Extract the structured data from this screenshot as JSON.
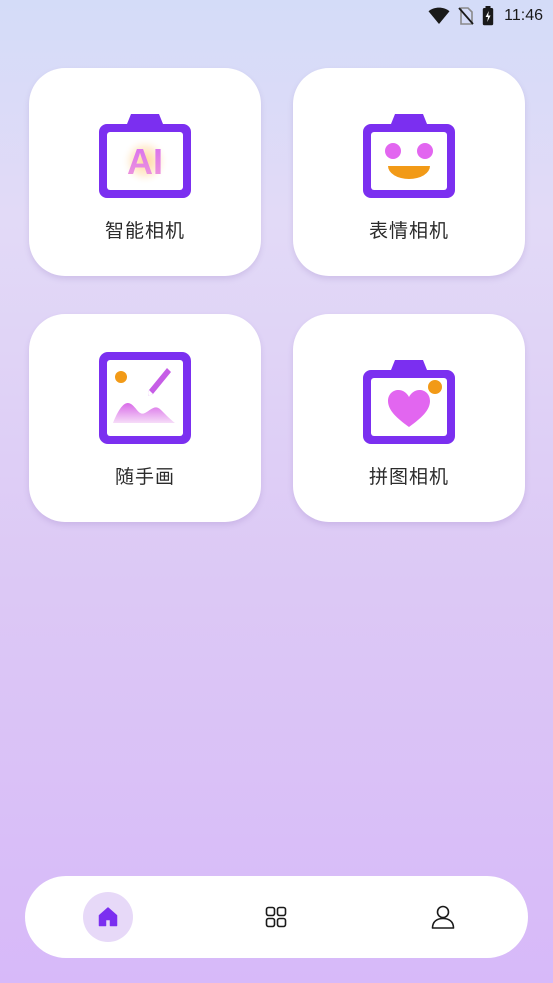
{
  "status_bar": {
    "time": "11:46",
    "icons": [
      "wifi-icon",
      "no-sim-icon",
      "battery-charging-icon"
    ]
  },
  "features": [
    {
      "label": "智能相机",
      "icon": "ai-camera-icon",
      "icon_text": "AI"
    },
    {
      "label": "表情相机",
      "icon": "emoji-camera-icon"
    },
    {
      "label": "随手画",
      "icon": "doodle-icon"
    },
    {
      "label": "拼图相机",
      "icon": "puzzle-camera-icon"
    }
  ],
  "bottom_nav": {
    "items": [
      {
        "name": "home",
        "icon": "home-icon",
        "active": true
      },
      {
        "name": "apps",
        "icon": "grid-icon",
        "active": false
      },
      {
        "name": "profile",
        "icon": "user-icon",
        "active": false
      }
    ]
  },
  "colors": {
    "accent": "#7b2ff0",
    "active_nav_bg": "#e7d9f8",
    "orange": "#f29a17",
    "pink": "#e266f0"
  }
}
